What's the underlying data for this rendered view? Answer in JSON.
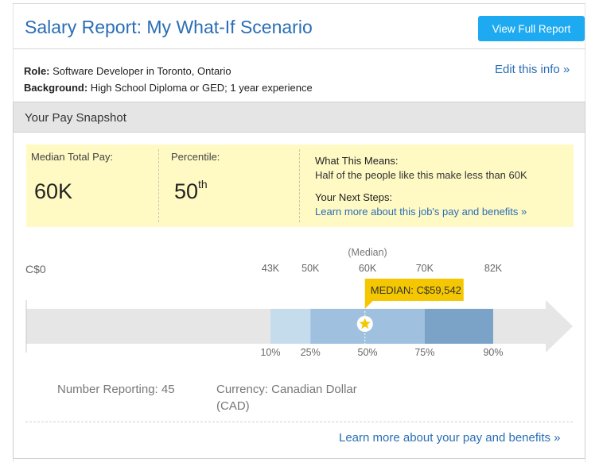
{
  "header": {
    "title": "Salary Report: My What-If Scenario",
    "view_report_label": "View Full Report"
  },
  "info": {
    "role_label": "Role:",
    "role_value": "Software Developer in Toronto, Ontario",
    "background_label": "Background:",
    "background_value": "High School Diploma or GED; 1 year experience",
    "edit_link": "Edit this info »"
  },
  "snapshot": {
    "title": "Your Pay Snapshot",
    "median_label": "Median Total Pay:",
    "median_value": "60K",
    "percentile_label": "Percentile:",
    "percentile_value": "50",
    "percentile_suffix": "th",
    "means_heading": "What This Means:",
    "means_text": "Half of the people like this make less than 60K",
    "steps_heading": "Your Next Steps:",
    "steps_link": "Learn more about this job's pay and benefits »"
  },
  "chart_data": {
    "type": "bar",
    "title": "",
    "start_label": "C$0",
    "median_caption": "(Median)",
    "median_callout": "MEDIAN: C$59,542",
    "median_value": 59542,
    "axis_end": 100,
    "ranges": [
      {
        "from": 43,
        "to": 50,
        "color": "#c5dcec"
      },
      {
        "from": 50,
        "to": 70,
        "color": "#9fc1df"
      },
      {
        "from": 70,
        "to": 82,
        "color": "#7aa3c7"
      }
    ],
    "values_k": [
      43,
      50,
      60,
      70,
      82
    ],
    "value_labels": [
      "43K",
      "50K",
      "60K",
      "70K",
      "82K"
    ],
    "percentiles": [
      10,
      25,
      50,
      75,
      90
    ],
    "percentile_labels": [
      "10%",
      "25%",
      "50%",
      "75%",
      "90%"
    ],
    "colors": {
      "track": "#e6e6e6",
      "callout": "#f5c700",
      "star": "#f5c700"
    }
  },
  "footer": {
    "number_reporting": "Number Reporting: 45",
    "currency_line1": "Currency: Canadian Dollar",
    "currency_line2": "(CAD)",
    "bottom_link": "Learn more about your pay and benefits »"
  }
}
